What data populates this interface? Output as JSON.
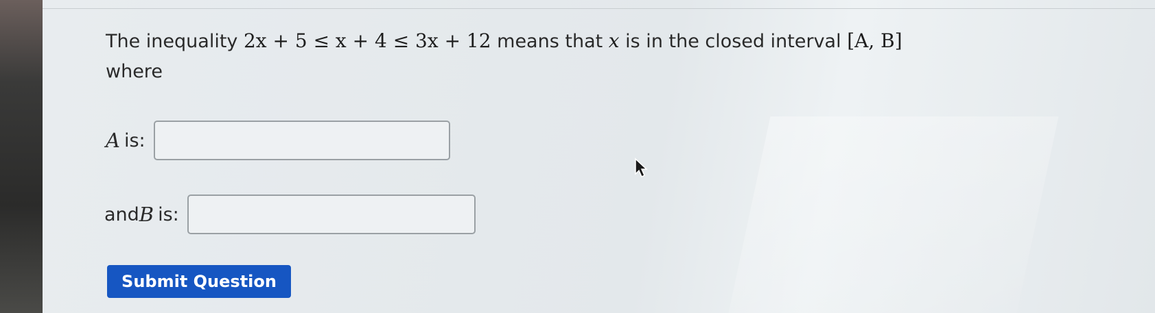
{
  "question": {
    "prefix": "The inequality ",
    "inequality": "2x + 5 ≤ x + 4 ≤ 3x + 12",
    "middle": " means that ",
    "variable": "x",
    "suffix": " is in the closed interval ",
    "interval": "[A, B]",
    "line2": "where"
  },
  "fields": {
    "a_var": "A",
    "a_label": " is:",
    "a_value": "",
    "b_prefix": "and ",
    "b_var": "B",
    "b_label": " is:",
    "b_value": ""
  },
  "submit": {
    "label": "Submit Question"
  },
  "colors": {
    "button": "#1656c2",
    "text": "#2a2a2a"
  },
  "icons": {
    "cursor": "mouse-pointer-icon"
  }
}
